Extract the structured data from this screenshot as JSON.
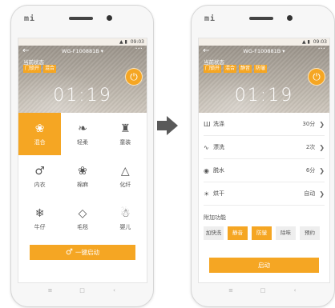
{
  "left_phone": {
    "brand": "mi",
    "status_time": "09:03",
    "device_name": "WG-F100881B ▾",
    "state_label": "当前状态",
    "state_chips": [
      "门锁开",
      "混合"
    ],
    "time": "01:19",
    "modes": [
      {
        "label": "混合",
        "icon": "❀",
        "active": true
      },
      {
        "label": "轻柔",
        "icon": "❧",
        "active": false
      },
      {
        "label": "童装",
        "icon": "♜",
        "active": false
      },
      {
        "label": "内衣",
        "icon": "♂",
        "active": false
      },
      {
        "label": "棉麻",
        "icon": "❀",
        "active": false
      },
      {
        "label": "化纤",
        "icon": "△",
        "active": false
      },
      {
        "label": "牛仔",
        "icon": "❄",
        "active": false
      },
      {
        "label": "毛毯",
        "icon": "◇",
        "active": false
      },
      {
        "label": "婴儿",
        "icon": "☃",
        "active": false
      }
    ],
    "start_label": "一键启动"
  },
  "right_phone": {
    "brand": "mi",
    "status_time": "09:03",
    "device_name": "WG-F100881B ▾",
    "state_label": "当前状态",
    "state_chips": [
      "门锁开",
      "混合",
      "静音",
      "防皱"
    ],
    "time": "01:19",
    "settings": [
      {
        "icon": "Ш",
        "label": "洗涤",
        "value": "30分"
      },
      {
        "icon": "∿",
        "label": "漂洗",
        "value": "2次"
      },
      {
        "icon": "◉",
        "label": "脱水",
        "value": "6分"
      },
      {
        "icon": "☀",
        "label": "烘干",
        "value": "自动"
      }
    ],
    "additional_title": "附加功能",
    "options": [
      {
        "label": "加快洗",
        "on": false
      },
      {
        "label": "静音",
        "on": true
      },
      {
        "label": "防皱",
        "on": true
      },
      {
        "label": "除味",
        "on": false
      },
      {
        "label": "预约",
        "on": false
      }
    ],
    "start_label": "启动"
  },
  "nav_buttons": [
    "≡",
    "□",
    "‹"
  ],
  "colors": {
    "accent": "#f5a623",
    "arrow": "#595959"
  }
}
